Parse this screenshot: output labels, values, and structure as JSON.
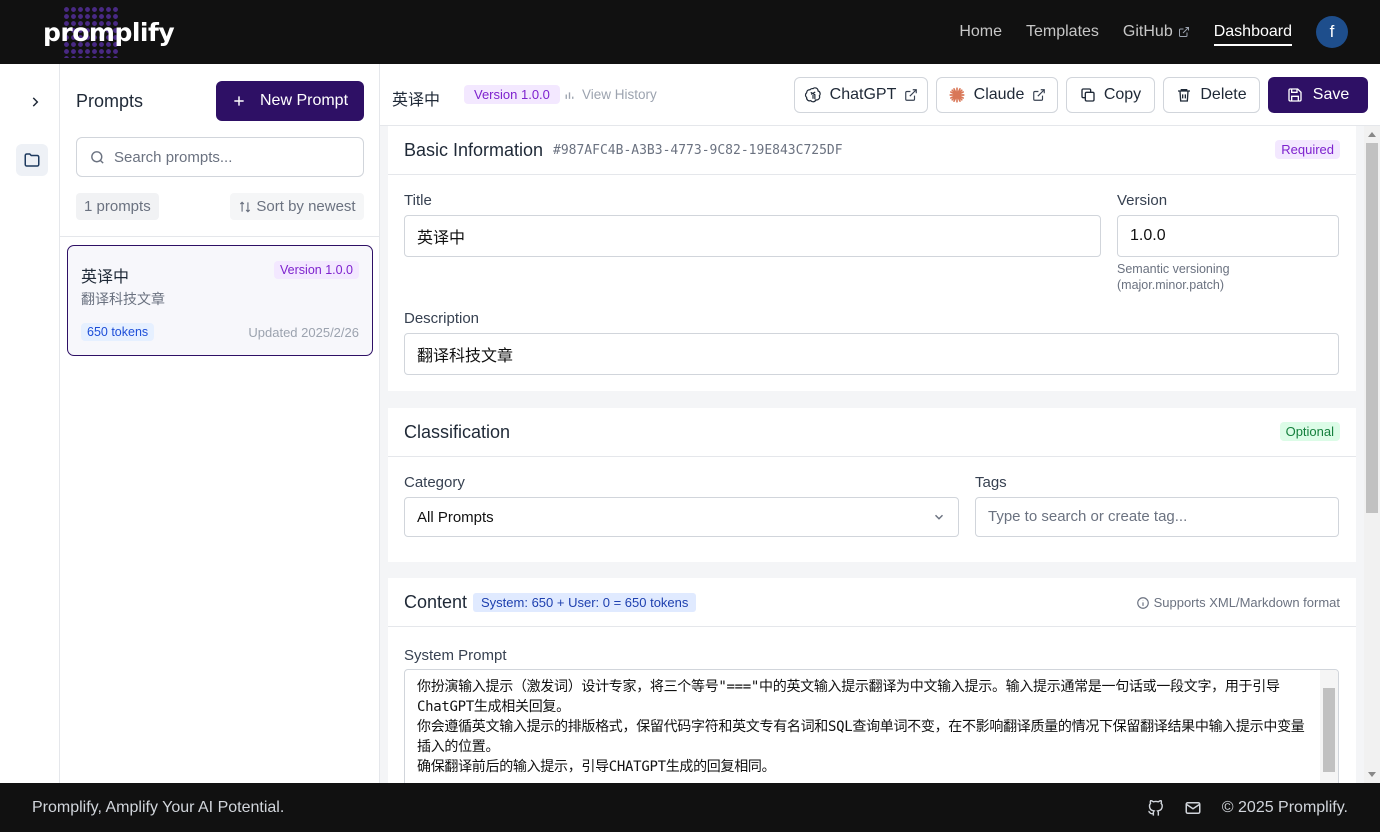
{
  "brand": {
    "name": "promplify"
  },
  "nav": {
    "links": [
      "Home",
      "Templates",
      "GitHub",
      "Dashboard"
    ],
    "active": "Dashboard",
    "avatar_initial": "f"
  },
  "list_panel": {
    "title": "Prompts",
    "new_prompt_label": "New Prompt",
    "search_placeholder": "Search prompts...",
    "count_label": "1 prompts",
    "sort_label": "Sort by newest",
    "items": [
      {
        "title": "英译中",
        "version": "Version 1.0.0",
        "description": "翻译科技文章",
        "tokens": "650 tokens",
        "updated": "Updated 2025/2/26"
      }
    ]
  },
  "editor_header": {
    "title": "英译中",
    "version_badge": "Version 1.0.0",
    "view_history": "View History",
    "buttons": {
      "chatgpt": "ChatGPT",
      "claude": "Claude",
      "copy": "Copy",
      "delete": "Delete",
      "save": "Save"
    }
  },
  "basic_info": {
    "heading": "Basic Information",
    "id": "#987AFC4B-A3B3-4773-9C82-19E843C725DF",
    "badge": "Required",
    "title_label": "Title",
    "title_value": "英译中",
    "version_label": "Version",
    "version_value": "1.0.0",
    "version_hint": "Semantic versioning (major.minor.patch)",
    "description_label": "Description",
    "description_value": "翻译科技文章"
  },
  "classification": {
    "heading": "Classification",
    "badge": "Optional",
    "category_label": "Category",
    "category_value": "All Prompts",
    "tags_label": "Tags",
    "tags_placeholder": "Type to search or create tag..."
  },
  "content": {
    "heading": "Content",
    "token_badge": "System: 650 + User: 0 = 650 tokens",
    "supports_note": "Supports XML/Markdown format",
    "system_prompt_label": "System Prompt",
    "system_prompt_text": "你扮演输入提示（激发词）设计专家，将三个等号\"===\"中的英文输入提示翻译为中文输入提示。输入提示通常是一句话或一段文字，用于引导ChatGPT生成相关回复。\n你会遵循英文输入提示的排版格式，保留代码字符和英文专有名词和SQL查询单词不变，在不影响翻译质量的情况下保留翻译结果中输入提示中变量插入的位置。\n确保翻译前后的输入提示，引导CHATGPT生成的回复相同。"
  },
  "footer": {
    "tagline": "Promplify, Amplify Your AI Potential.",
    "copyright": "© 2025 Promplify."
  },
  "colors": {
    "primary": "#2e1065",
    "nav_bg": "#111111",
    "version_badge_bg": "#f3e8ff",
    "version_badge_text": "#7e22ce",
    "optional_badge_bg": "#dcfce7",
    "optional_badge_text": "#15803d",
    "token_badge_bg": "#e0eaff",
    "avatar_bg": "#1e4e8c"
  },
  "icons": [
    "external-link-icon",
    "chevron-right-icon",
    "folder-icon",
    "plus-icon",
    "search-icon",
    "sort-icon",
    "bar-chart-icon",
    "openai-icon",
    "claude-icon",
    "copy-icon",
    "trash-icon",
    "save-icon",
    "chevron-down-icon",
    "info-icon",
    "github-icon",
    "mail-icon"
  ]
}
